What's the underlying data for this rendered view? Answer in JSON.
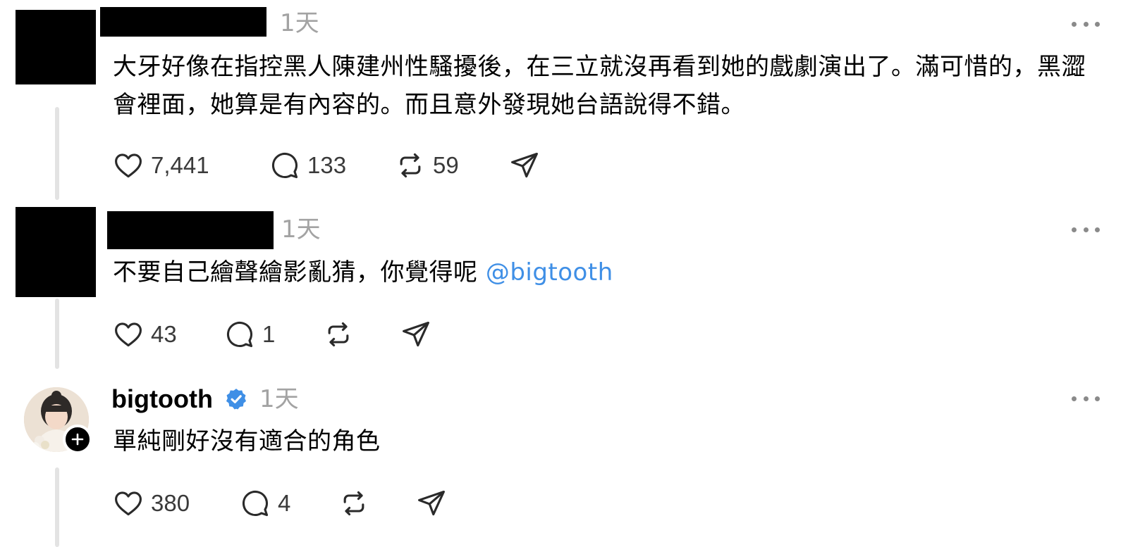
{
  "posts": [
    {
      "author": "",
      "time": "1天",
      "text": "大牙好像在指控黑人陳建州性騷擾後，在三立就沒再看到她的戲劇演出了。滿可惜的，黑澀會裡面，她算是有內容的。而且意外發現她台語說得不錯。",
      "likes": "7,441",
      "replies": "133",
      "reposts": "59"
    },
    {
      "author": "",
      "time": "1天",
      "text": "不要自己繪聲繪影亂猜，你覺得呢",
      "mention": "@bigtooth",
      "likes": "43",
      "replies": "1",
      "reposts": ""
    },
    {
      "author": "bigtooth",
      "verified": true,
      "time": "1天",
      "text": "單純剛好沒有適合的角色",
      "likes": "380",
      "replies": "4",
      "reposts": ""
    }
  ],
  "icons": {
    "like": "heart-icon",
    "reply": "comment-icon",
    "repost": "repost-icon",
    "share": "send-icon",
    "more": "more-dots-icon",
    "verified": "verified-badge-icon",
    "follow": "plus-icon"
  },
  "colors": {
    "mention": "#3f8fe6",
    "verified": "#3f8fe6",
    "timestamp": "#a3a3a3",
    "thread_line": "#e3e3e3"
  }
}
